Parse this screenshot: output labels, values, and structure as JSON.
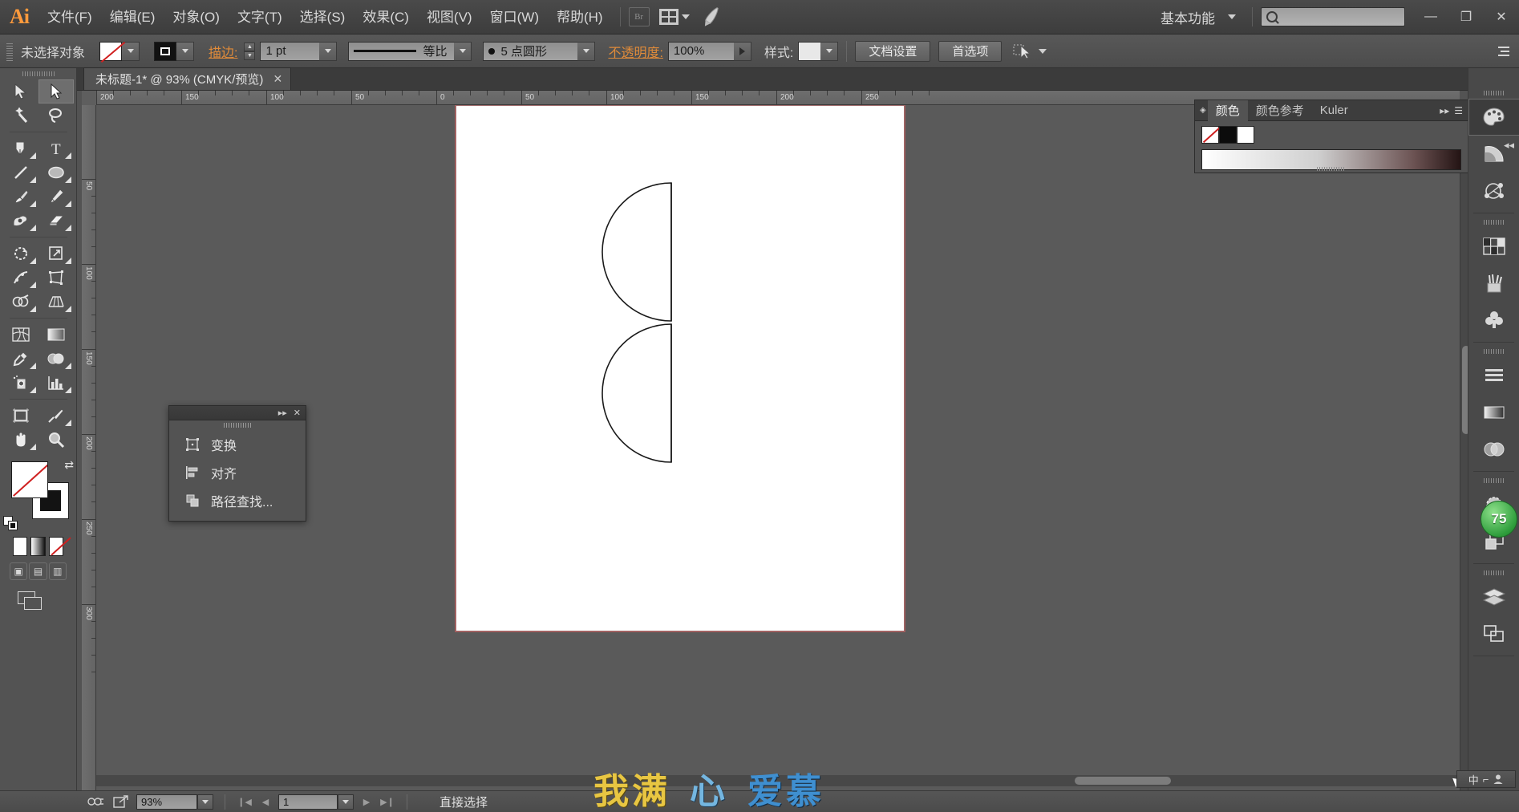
{
  "app": {
    "name": "Adobe Illustrator",
    "logo_text": "Ai"
  },
  "menubar": {
    "items": [
      {
        "label": "文件(F)",
        "name": "menu-file"
      },
      {
        "label": "编辑(E)",
        "name": "menu-edit"
      },
      {
        "label": "对象(O)",
        "name": "menu-object"
      },
      {
        "label": "文字(T)",
        "name": "menu-type"
      },
      {
        "label": "选择(S)",
        "name": "menu-select"
      },
      {
        "label": "效果(C)",
        "name": "menu-effect"
      },
      {
        "label": "视图(V)",
        "name": "menu-view"
      },
      {
        "label": "窗口(W)",
        "name": "menu-window"
      },
      {
        "label": "帮助(H)",
        "name": "menu-help"
      }
    ],
    "bridge_label": "Br",
    "workspace_label": "基本功能",
    "search_placeholder": "",
    "search_value": "",
    "window_buttons": {
      "minimize": "—",
      "maximize": "❐",
      "close": "✕"
    }
  },
  "controlbar": {
    "selection_status": "未选择对象",
    "fill_swatch": "none",
    "stroke_swatch": "black-square",
    "stroke_label": "描边:",
    "stroke_weight": "1 pt",
    "stroke_profile": "等比",
    "brush_definition": "5 点圆形",
    "opacity_label": "不透明度:",
    "opacity_value": "100%",
    "style_label": "样式:",
    "doc_setup_button": "文档设置",
    "preferences_button": "首选项"
  },
  "tabbar": {
    "document_tab": "未标题-1* @ 93% (CMYK/预览)",
    "close_glyph": "✕"
  },
  "toolbar": {
    "tools": [
      {
        "name": "selection-tool",
        "label": "选择工具",
        "selected": false
      },
      {
        "name": "direct-selection-tool",
        "label": "直接选择工具",
        "selected": true
      },
      {
        "name": "magic-wand-tool",
        "label": "魔棒工具",
        "selected": false
      },
      {
        "name": "lasso-tool",
        "label": "套索工具",
        "selected": false
      },
      {
        "name": "pen-tool",
        "label": "钢笔工具",
        "selected": false
      },
      {
        "name": "type-tool",
        "label": "文字工具",
        "selected": false
      },
      {
        "name": "line-segment-tool",
        "label": "直线段工具",
        "selected": false
      },
      {
        "name": "ellipse-tool",
        "label": "椭圆工具",
        "selected": false
      },
      {
        "name": "paintbrush-tool",
        "label": "画笔工具",
        "selected": false
      },
      {
        "name": "pencil-tool",
        "label": "铅笔工具",
        "selected": false
      },
      {
        "name": "blob-brush-tool",
        "label": "斑点画笔工具",
        "selected": false
      },
      {
        "name": "eraser-tool",
        "label": "橡皮擦工具",
        "selected": false
      },
      {
        "name": "rotate-tool",
        "label": "旋转工具",
        "selected": false
      },
      {
        "name": "scale-tool",
        "label": "比例缩放工具",
        "selected": false
      },
      {
        "name": "width-tool",
        "label": "宽度工具",
        "selected": false
      },
      {
        "name": "free-transform-tool",
        "label": "自由变换工具",
        "selected": false
      },
      {
        "name": "shape-builder-tool",
        "label": "形状生成器工具",
        "selected": false
      },
      {
        "name": "perspective-grid-tool",
        "label": "透视网格工具",
        "selected": false
      },
      {
        "name": "mesh-tool",
        "label": "网格工具",
        "selected": false
      },
      {
        "name": "gradient-tool",
        "label": "渐变工具",
        "selected": false
      },
      {
        "name": "eyedropper-tool",
        "label": "吸管工具",
        "selected": false
      },
      {
        "name": "blend-tool",
        "label": "混合工具",
        "selected": false
      },
      {
        "name": "symbol-sprayer-tool",
        "label": "符号喷枪工具",
        "selected": false
      },
      {
        "name": "column-graph-tool",
        "label": "柱形图工具",
        "selected": false
      },
      {
        "name": "artboard-tool",
        "label": "画板工具",
        "selected": false
      },
      {
        "name": "slice-tool",
        "label": "切片工具",
        "selected": false
      },
      {
        "name": "hand-tool",
        "label": "抓手工具",
        "selected": false
      },
      {
        "name": "zoom-tool",
        "label": "缩放工具",
        "selected": false
      }
    ],
    "fill_state": "none",
    "stroke_state": "black",
    "color_modes": [
      "color",
      "gradient",
      "none"
    ],
    "screen_modes": [
      "正常屏幕模式"
    ]
  },
  "float_panel": {
    "collapse_glyph": "▸▸",
    "close_glyph": "✕",
    "items": [
      {
        "label": "变换",
        "icon": "transform-icon"
      },
      {
        "label": "对齐",
        "icon": "align-icon"
      },
      {
        "label": "路径查找...",
        "icon": "pathfinder-icon"
      }
    ]
  },
  "color_panel": {
    "tabs": [
      {
        "label": "颜色",
        "active": true
      },
      {
        "label": "颜色参考",
        "active": false
      },
      {
        "label": "Kuler",
        "active": false
      }
    ],
    "swatches": [
      "none",
      "black",
      "white"
    ],
    "ramp_description": "灰度色谱"
  },
  "dock": {
    "buttons": [
      {
        "name": "dock-color",
        "icon": "palette-icon",
        "selected": true
      },
      {
        "name": "dock-color-guide",
        "icon": "color-guide-icon",
        "selected": false
      },
      {
        "name": "dock-kuler",
        "icon": "kuler-icon",
        "selected": false
      },
      {
        "name": "dock-swatches",
        "icon": "swatches-icon",
        "selected": false
      },
      {
        "name": "dock-brushes",
        "icon": "brushes-icon",
        "selected": false
      },
      {
        "name": "dock-symbols",
        "icon": "symbols-icon",
        "selected": false
      },
      {
        "name": "dock-stroke",
        "icon": "stroke-icon",
        "selected": false
      },
      {
        "name": "dock-gradient",
        "icon": "gradient-icon",
        "selected": false
      },
      {
        "name": "dock-transparency",
        "icon": "transparency-icon",
        "selected": false
      },
      {
        "name": "dock-appearance",
        "icon": "appearance-icon",
        "selected": false
      },
      {
        "name": "dock-graphic-styles",
        "icon": "graphic-styles-icon",
        "selected": false
      },
      {
        "name": "dock-layers",
        "icon": "layers-icon",
        "selected": false
      },
      {
        "name": "dock-artboards",
        "icon": "artboards-icon",
        "selected": false
      }
    ],
    "badge_value": "75"
  },
  "rulers": {
    "unit": "mm",
    "h_labels": [
      "200",
      "150",
      "100",
      "50",
      "0",
      "50",
      "100",
      "150",
      "200",
      "250"
    ],
    "v_labels": [
      "50",
      "100",
      "150",
      "200",
      "250",
      "300"
    ]
  },
  "canvas": {
    "zoom": "93%",
    "artboard_color": "#ffffff",
    "shapes": [
      {
        "name": "upper-half-circle",
        "type": "semicircle",
        "orientation": "left"
      },
      {
        "name": "lower-half-circle",
        "type": "semicircle",
        "orientation": "left"
      }
    ]
  },
  "statusbar": {
    "zoom_value": "93%",
    "page_value": "1",
    "status_text": "直接选择",
    "nav_first": "❙◀",
    "nav_prev": "◀",
    "nav_next": "▶",
    "nav_last": "▶❙"
  },
  "overlay_text": {
    "part1": "我满",
    "part2": "心",
    "part3": "爱慕"
  },
  "ime": {
    "lang": "中",
    "mode": "⌐",
    "icon": "ime-icon"
  },
  "colors": {
    "accent_orange": "#e08b3a",
    "panel_bg": "#535353",
    "menubar_bg": "#434343",
    "canvas_bg": "#5a5a5a",
    "artboard_border": "#a85c5c",
    "badge_green": "#2f9e3c",
    "overlay_yellow": "#e8c642",
    "overlay_blue": "#3f8fd0"
  }
}
